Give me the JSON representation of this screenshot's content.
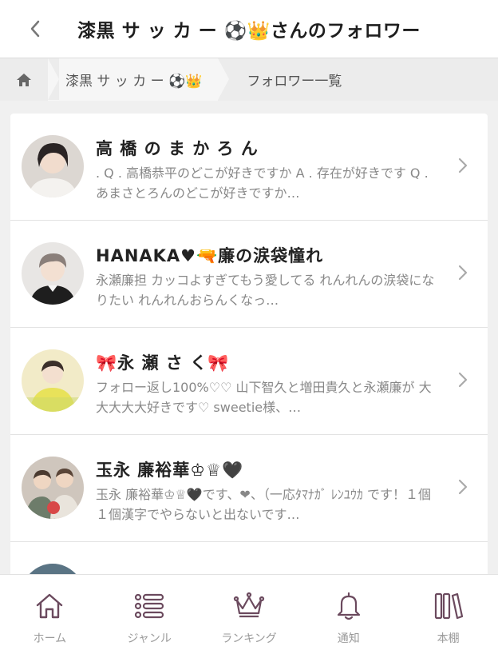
{
  "header": {
    "title": "漆黒 サ ッ カ ー ⚽👑さんのフォロワー",
    "back_icon": "chevron-left-icon"
  },
  "breadcrumb": {
    "home_icon": "home-icon",
    "user": "漆黒 サ ッ カ ー ⚽👑",
    "current": "フォロワー一覧"
  },
  "followers": [
    {
      "name": "高 橋 の ま か ろ ん",
      "bio": ". Q . 高橋恭平のどこが好きですか A . 存在が好きです Q . あまさとろんのどこが好きですか…"
    },
    {
      "name": "HANAKA♥🔫廉の涙袋憧れ",
      "bio": "永瀬廉担 カッコよすぎてもう愛してる れんれんの涙袋になりたい れんれんおらんくなっ…"
    },
    {
      "name": "🎀永 瀬 さ く🎀",
      "bio": "フォロー返し100%♡♡ 山下智久と増田貴久と永瀬廉が 大大大大大好きです♡ sweetie様、…"
    },
    {
      "name": "玉永 廉裕華♔♕🖤",
      "bio": "玉永 廉裕華♔♕🖤です、❤︎、（一応ﾀﾏﾅｶﾞ ﾚﾝﾕｳｶ です！１個１個漢字でやらないと出ないです…"
    }
  ],
  "bottom_nav": [
    {
      "label": "ホーム",
      "icon": "home-icon"
    },
    {
      "label": "ジャンル",
      "icon": "list-icon"
    },
    {
      "label": "ランキング",
      "icon": "crown-icon"
    },
    {
      "label": "通知",
      "icon": "bell-icon"
    },
    {
      "label": "本棚",
      "icon": "bookshelf-icon"
    }
  ],
  "colors": {
    "accent_icon": "#6b4a5e",
    "text_muted": "#888888"
  }
}
